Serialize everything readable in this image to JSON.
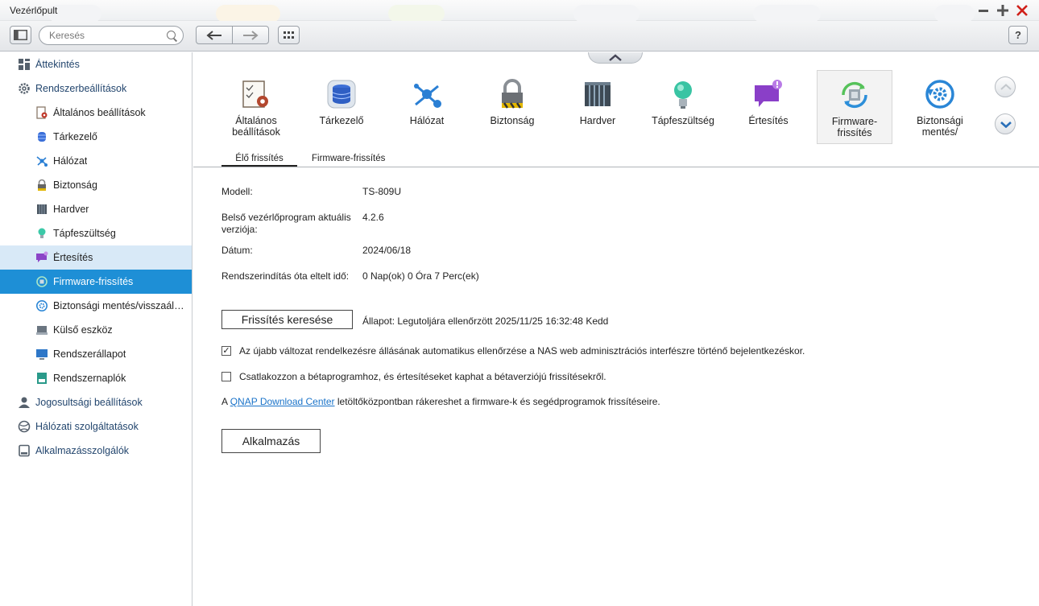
{
  "window": {
    "title": "Vezérlőpult"
  },
  "toolbar": {
    "search_placeholder": "Keresés"
  },
  "sidebar": {
    "items": [
      {
        "label": "Áttekintés"
      },
      {
        "label": "Rendszerbeállítások"
      },
      {
        "label": "Általános beállítások"
      },
      {
        "label": "Tárkezelő"
      },
      {
        "label": "Hálózat"
      },
      {
        "label": "Biztonság"
      },
      {
        "label": "Hardver"
      },
      {
        "label": "Tápfeszültség"
      },
      {
        "label": "Értesítés"
      },
      {
        "label": "Firmware-frissítés"
      },
      {
        "label": "Biztonsági mentés/visszaállítás"
      },
      {
        "label": "Külső eszköz"
      },
      {
        "label": "Rendszerállapot"
      },
      {
        "label": "Rendszernaplók"
      },
      {
        "label": "Jogosultsági beállítások"
      },
      {
        "label": "Hálózati szolgáltatások"
      },
      {
        "label": "Alkalmazásszolgálók"
      }
    ]
  },
  "icons": [
    {
      "line1": "Általános",
      "line2": "beállítások"
    },
    {
      "line1": "Tárkezelő",
      "line2": ""
    },
    {
      "line1": "Hálózat",
      "line2": ""
    },
    {
      "line1": "Biztonság",
      "line2": ""
    },
    {
      "line1": "Hardver",
      "line2": ""
    },
    {
      "line1": "Tápfeszültség",
      "line2": ""
    },
    {
      "line1": "Értesítés",
      "line2": ""
    },
    {
      "line1": "Firmware-",
      "line2": "frissítés"
    },
    {
      "line1": "Biztonsági",
      "line2": "mentés/"
    }
  ],
  "tabs": {
    "live": "Élő frissítés",
    "firmware": "Firmware-frissítés"
  },
  "info": {
    "model_label": "Modell:",
    "model_value": "TS-809U",
    "fw_label": "Belső vezérlőprogram aktuális verziója:",
    "fw_value": "4.2.6",
    "date_label": "Dátum:",
    "date_value": "2024/06/18",
    "uptime_label": "Rendszerindítás óta eltelt idő:",
    "uptime_value": "0 Nap(ok) 0 Óra 7 Perc(ek)"
  },
  "update": {
    "check_button": "Frissítés keresése",
    "status": "Állapot: Legutoljára ellenőrzött 2025/11/25 16:32:48 Kedd",
    "auto_check_label": "Az újabb változat rendelkezésre állásának automatikus ellenőrzése a NAS web adminisztrációs interfészre történő bejelentkezéskor.",
    "auto_check_checked": true,
    "beta_label": "Csatlakozzon a bétaprogramhoz, és értesítéseket kaphat a bétaverziójú frissítésekről.",
    "beta_checked": false,
    "dl_prefix": "A ",
    "dl_link": "QNAP Download Center",
    "dl_suffix": " letöltőközpontban rákereshet a firmware-k és segédprogramok frissítéseire.",
    "apply_button": "Alkalmazás"
  },
  "colors": {
    "accent": "#1e8fd6",
    "hover": "#d8e9f7",
    "link": "#1a73c9"
  }
}
